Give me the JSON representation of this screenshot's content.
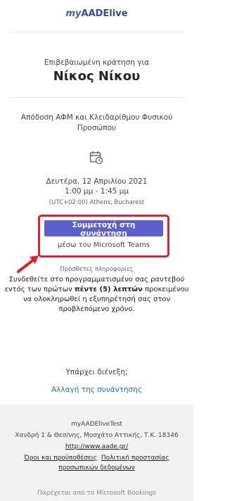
{
  "header": {
    "logo_prefix": "my",
    "logo_suffix": "AADElive"
  },
  "booking": {
    "confirmed_label": "Επιβεβαιωμένη κράτηση για",
    "customer_name": "Νίκος Νίκου",
    "service_name": "Απόδοση ΑΦΜ και Κλειδαρίθμου Φυσικού Προσώπου",
    "date": "Δευτέρα, 12 Απριλίου 2021",
    "time": "1:00 μμ - 1:45 μμ",
    "timezone": "(UTC+02:00) Athens, Bucharest"
  },
  "join": {
    "button_label": "Συμμετοχή στη συνάντηση",
    "via_label": "μέσω του Microsoft Teams",
    "highlight_color": "#d9232e",
    "button_color": "#5b5fc7"
  },
  "notes": {
    "title": "Πρόσθετες πληροφορίες",
    "text_before": "Συνδεθείτε στο προγραμματισμένο σας ραντεβού εντός των πρώτων ",
    "text_bold": "πέντε (5) λεπτών",
    "text_after": " προκειμένου να ολοκληρωθεί η εξυπηρέτησή σας στον προβλεπόμενο χρόνο."
  },
  "change": {
    "question": "Υπάρχει διένεξη;",
    "link_label": "Αλλαγή της συνάντησης"
  },
  "footer": {
    "business_name": "myAADEliveTest",
    "address": "Χανδρή 1 & Θεσ/νης, Μοσχάτο Αττικής, Τ.Κ. 18346",
    "website": "http://www.aade.gr/",
    "terms_label": "Όροι και προϋποθέσεις",
    "privacy_label_line1": "Πολιτική προστασίας",
    "privacy_label_line2": "προσωπικών δεδομένων",
    "powered_by": "Παρέχεται από το Microsoft Bookings"
  },
  "icons": {
    "calendar": "calendar-clock-icon",
    "arrow": "red-arrow-icon"
  }
}
